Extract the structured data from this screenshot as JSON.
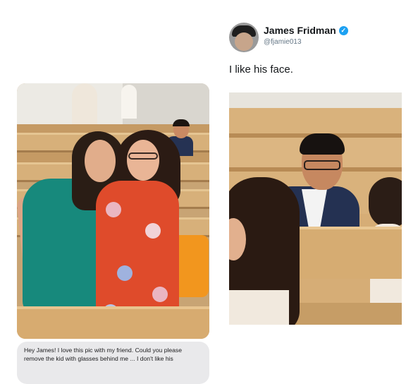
{
  "tweet": {
    "author_name": "James Fridman",
    "handle": "@fjamie013",
    "verified": true,
    "text": "I like his face."
  },
  "message": {
    "text": "Hey James! I love this pic with my friend. Could you please remove the kid with glasses behind me ... I don't like his"
  },
  "colors": {
    "verified_badge": "#1da1f2",
    "bubble_bg": "#e9e9eb"
  },
  "icons": {
    "verified": "verified-check-icon"
  }
}
